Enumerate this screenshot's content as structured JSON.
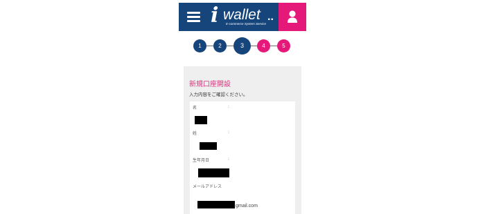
{
  "header": {
    "logo": {
      "mark": "i",
      "word": "wallet",
      "dots": "..",
      "tagline": "E-commerce System Service"
    },
    "menu_icon": "hamburger-icon",
    "user_icon": "user-icon",
    "colors": {
      "header_bg": "#16457b",
      "user_bg": "#e4197a"
    }
  },
  "stepper": {
    "current": 3,
    "steps": [
      {
        "label": "1",
        "state": "done"
      },
      {
        "label": "2",
        "state": "done"
      },
      {
        "label": "3",
        "state": "current"
      },
      {
        "label": "4",
        "state": "pending"
      },
      {
        "label": "5",
        "state": "pending"
      }
    ],
    "colors": {
      "done": "#16457b",
      "pending": "#e4197a"
    }
  },
  "form": {
    "title": "新規口座開設",
    "instruction": "入力内容をご確認ください。",
    "fields": [
      {
        "label": "名",
        "colon": ":"
      },
      {
        "label": "姓",
        "colon": ":"
      },
      {
        "label": "生年月日",
        "colon": ":"
      },
      {
        "label": "メールアドレス",
        "colon": ""
      }
    ],
    "email_suffix": "gmail.com"
  }
}
